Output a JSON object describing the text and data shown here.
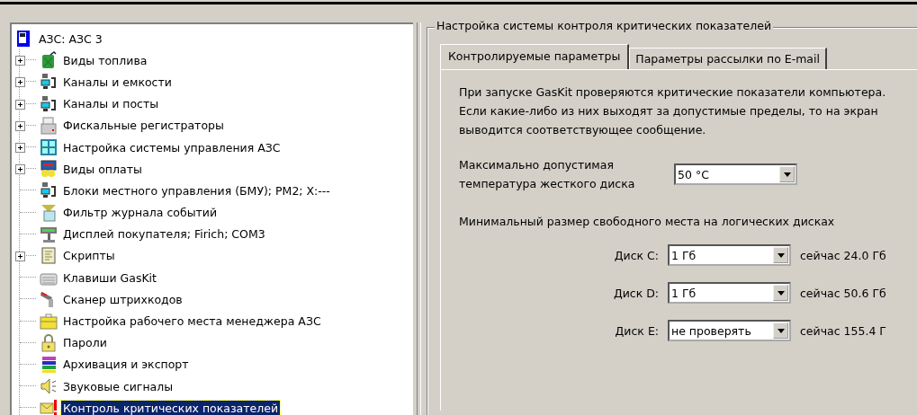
{
  "tree": {
    "root": {
      "label": "АЗС: АЗС 3",
      "kind": "station"
    },
    "items": [
      {
        "label": "Виды топлива",
        "kind": "fuel",
        "has_children": true,
        "selected": false
      },
      {
        "label": "Каналы и емкости",
        "kind": "channels",
        "has_children": true,
        "selected": false
      },
      {
        "label": "Каналы и посты",
        "kind": "channels",
        "has_children": true,
        "selected": false
      },
      {
        "label": "Фискальные регистраторы",
        "kind": "register",
        "has_children": true,
        "selected": false
      },
      {
        "label": "Настройка системы управления АЗС",
        "kind": "panel",
        "has_children": true,
        "selected": false
      },
      {
        "label": "Виды оплаты",
        "kind": "payment",
        "has_children": true,
        "selected": false
      },
      {
        "label": "Блоки местного управления (БМУ);  РМ2;  X:---",
        "kind": "channels",
        "has_children": false,
        "selected": false
      },
      {
        "label": "Фильтр журнала событий",
        "kind": "filter",
        "has_children": false,
        "selected": false
      },
      {
        "label": "Дисплей покупателя; Firich; COM3",
        "kind": "display",
        "has_children": false,
        "selected": false
      },
      {
        "label": "Скрипты",
        "kind": "script",
        "has_children": true,
        "selected": false
      },
      {
        "label": "Клавиши GasKit",
        "kind": "keyboard",
        "has_children": false,
        "selected": false
      },
      {
        "label": "Сканер штрихкодов",
        "kind": "scanner",
        "has_children": false,
        "selected": false
      },
      {
        "label": "Настройка рабочего места менеджера АЗС",
        "kind": "briefcase",
        "has_children": false,
        "selected": false
      },
      {
        "label": "Пароли",
        "kind": "lock",
        "has_children": false,
        "selected": false
      },
      {
        "label": "Архивация и экспорт",
        "kind": "archive",
        "has_children": false,
        "selected": false
      },
      {
        "label": "Звуковые сигналы",
        "kind": "sound",
        "has_children": false,
        "selected": false
      },
      {
        "label": "Контроль критических показателей",
        "kind": "alert",
        "has_children": false,
        "selected": true
      }
    ]
  },
  "group": {
    "title": "Настройка системы контроля критических показателей",
    "tabs": [
      {
        "label": "Контролируемые параметры",
        "selected": true
      },
      {
        "label": "Параметры рассылки по E-mail",
        "selected": false
      }
    ],
    "description": "При запуске GasKit проверяются критические показатели компьютера. Если какие-либо из них выходят за допустимые пределы, то на экран выводится соответствующее сообщение.",
    "temperature": {
      "label": "Максимально допустимая температура жесткого диска",
      "value": "50 °C"
    },
    "disks_heading": "Минимальный размер свободного места на логических дисках",
    "disks": [
      {
        "label": "Диск C:",
        "value": "1 Гб",
        "reading": "сейчас 24.0 Гб"
      },
      {
        "label": "Диск D:",
        "value": "1 Гб",
        "reading": "сейчас 50.6 Гб"
      },
      {
        "label": "Диск E:",
        "value": "не проверять",
        "reading": "сейчас 155.4 Г"
      }
    ]
  }
}
